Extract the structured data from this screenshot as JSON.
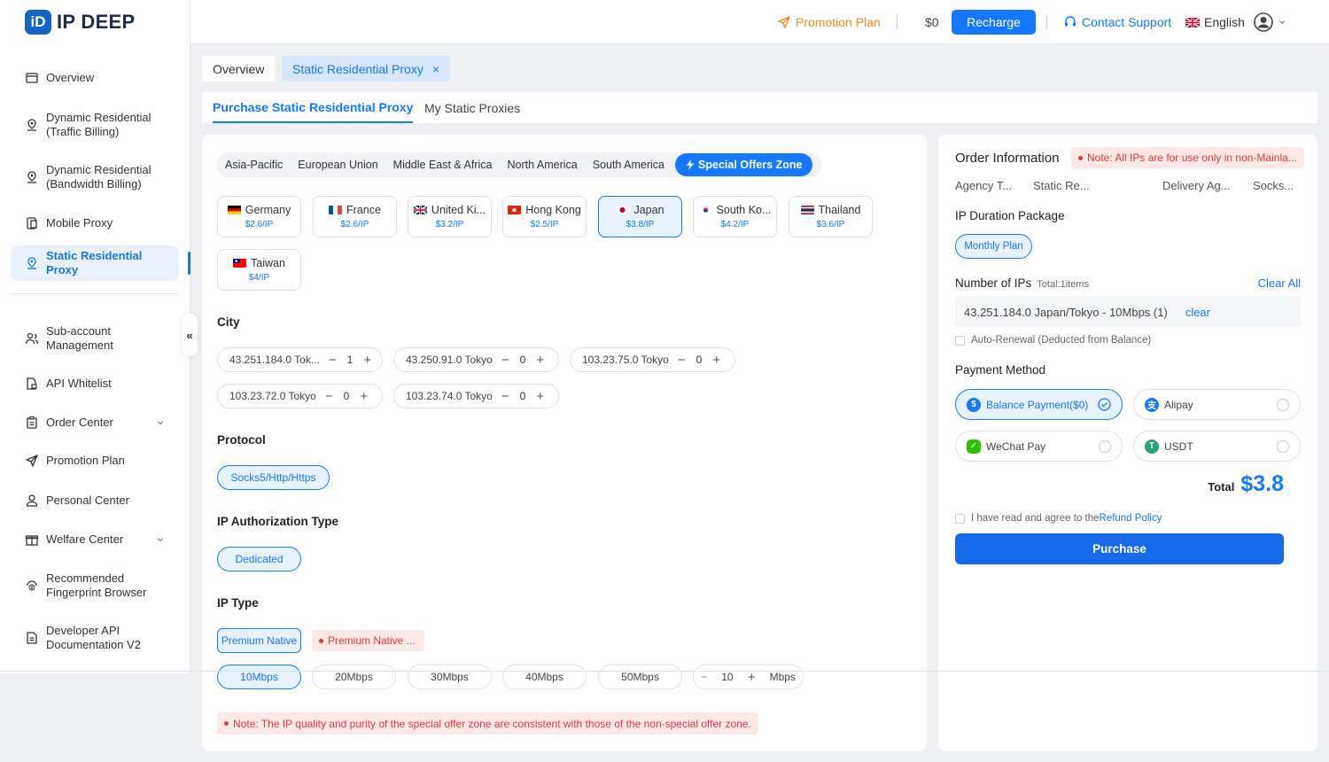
{
  "brand": {
    "logo_mark": "iD",
    "name": "IP DEEP",
    "accent": "#1677ff"
  },
  "sidebar": {
    "items": [
      {
        "label": "Overview",
        "icon": "window-icon"
      },
      {
        "label": "Dynamic Residential (Traffic Billing)",
        "icon": "pin-user-icon"
      },
      {
        "label": "Dynamic Residential (Bandwidth Billing)",
        "icon": "pin-user-icon"
      },
      {
        "label": "Mobile Proxy",
        "icon": "mobile-icon"
      },
      {
        "label": "Static Residential Proxy",
        "icon": "location-icon",
        "active": true
      },
      {
        "label": "Sub-account Management",
        "icon": "users-icon"
      },
      {
        "label": "API Whitelist",
        "icon": "file-lock-icon"
      },
      {
        "label": "Order Center",
        "icon": "clipboard-icon",
        "expandable": true
      },
      {
        "label": "Promotion Plan",
        "icon": "send-icon"
      },
      {
        "label": "Personal Center",
        "icon": "user-icon"
      },
      {
        "label": "Welfare Center",
        "icon": "gift-icon",
        "expandable": true
      },
      {
        "label": "Recommended Fingerprint Browser",
        "icon": "fingerprint-icon"
      },
      {
        "label": "Developer API Documentation V2",
        "icon": "doc-icon"
      }
    ],
    "collapse_glyph": "«"
  },
  "topbar": {
    "promotion": "Promotion Plan",
    "balance": "$0",
    "recharge": "Recharge",
    "support": "Contact Support",
    "language": "English"
  },
  "page_tabs": {
    "overview": "Overview",
    "current": "Static Residential Proxy",
    "close": "×"
  },
  "sub_tabs": {
    "purchase": "Purchase Static Residential Proxy",
    "mine": "My Static Proxies"
  },
  "regions": [
    "Asia-Pacific",
    "European Union",
    "Middle East & Africa",
    "North America",
    "South America"
  ],
  "special_zone": "Special Offers Zone",
  "countries": [
    {
      "name": "Germany",
      "price": "$2.6/IP"
    },
    {
      "name": "France",
      "price": "$2.6/IP"
    },
    {
      "name": "United Ki...",
      "price": "$3.2/IP"
    },
    {
      "name": "Hong Kong",
      "price": "$2.5/IP"
    },
    {
      "name": "Japan",
      "price": "$3.8/IP",
      "selected": true
    },
    {
      "name": "South Ko...",
      "price": "$4.2/IP"
    },
    {
      "name": "Thailand",
      "price": "$3.6/IP"
    },
    {
      "name": "Taiwan",
      "price": "$4/IP"
    }
  ],
  "city": {
    "title": "City",
    "items": [
      {
        "name": "43.251.184.0 Tok...",
        "qty": "1"
      },
      {
        "name": "43.250.91.0 Tokyo",
        "qty": "0"
      },
      {
        "name": "103.23.75.0 Tokyo",
        "qty": "0"
      },
      {
        "name": "103.23.72.0 Tokyo",
        "qty": "0"
      },
      {
        "name": "103.23.74.0 Tokyo",
        "qty": "0"
      }
    ]
  },
  "protocol": {
    "title": "Protocol",
    "value": "Socks5/Http/Https"
  },
  "auth": {
    "title": "IP Authorization Type",
    "value": "Dedicated"
  },
  "ip_type": {
    "title": "IP Type",
    "selected": "Premium Native",
    "other": "Premium Native ...",
    "bandwidths": [
      "10Mbps",
      "20Mbps",
      "30Mbps",
      "40Mbps",
      "50Mbps"
    ],
    "custom_value": "10",
    "custom_unit": "Mbps"
  },
  "special_note": "Note: The IP quality and purity of the special offer zone are consistent with those of the non-special offer zone.",
  "order": {
    "title": "Order Information",
    "note": "Note: All IPs are for use only in non-Mainla...",
    "meta": [
      "Agency T...",
      "Static Re...",
      "Delivery Ag...",
      "Socks..."
    ],
    "duration_label": "IP Duration Package",
    "duration_value": "Monthly Plan",
    "count_label": "Number of IPs",
    "count_total": "Total:1items",
    "clear_all": "Clear All",
    "ip_line": "43.251.184.0 Japan/Tokyo - 10Mbps (1)",
    "ip_clear": "clear",
    "auto_renew": "Auto-Renewal (Deducted from Balance)",
    "payment_label": "Payment Method",
    "payments": [
      {
        "label": "Balance Payment($0)",
        "selected": true
      },
      {
        "label": "Alipay"
      },
      {
        "label": "WeChat Pay"
      },
      {
        "label": "USDT"
      }
    ],
    "total_label": "Total",
    "total_value": "$3.8",
    "agree_text": "I have read and agree to the",
    "refund_link": "Refund Policy",
    "purchase": "Purchase"
  }
}
